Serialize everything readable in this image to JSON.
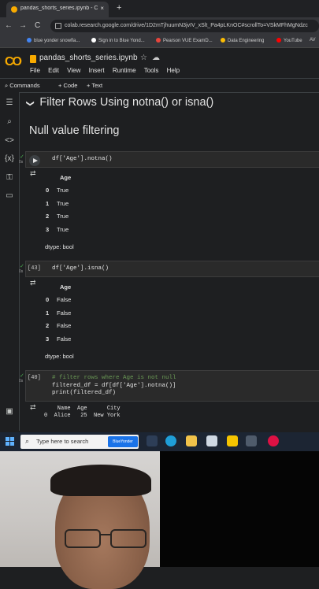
{
  "browser": {
    "tab_title": "pandas_shorts_series.ipynb - C",
    "tab_close": "×",
    "new_tab": "+",
    "url": "colab.research.google.com/drive/1D2mTjhuumN3jvIV_xSlt_Pa4pLKnOC#scrollTo=VSkMFhMgNdzc",
    "back": "←",
    "forward": "→",
    "reload": "C",
    "bookmarks": [
      {
        "label": "blue yonder snowfla...",
        "color": "#4285f4"
      },
      {
        "label": "Sign in to Blue Yond...",
        "color": "#ffffff"
      },
      {
        "label": "Pearson VUE ExamD...",
        "color": "#e8453c"
      },
      {
        "label": "Data Engineering",
        "color": "#fbbc04"
      },
      {
        "label": "YouTube",
        "color": "#ff0000"
      },
      {
        "label": "AV",
        "color": "#aaaaaa"
      }
    ]
  },
  "colab": {
    "logo": "CO",
    "notebook_title": "pandas_shorts_series.ipynb",
    "star": "☆",
    "cloud": "☁",
    "menu": [
      "File",
      "Edit",
      "View",
      "Insert",
      "Runtime",
      "Tools",
      "Help"
    ],
    "toolbar": {
      "commands": "Commands",
      "code": "+ Code",
      "text": "+ Text"
    }
  },
  "rail_icons": [
    "menu-icon",
    "search-icon",
    "code-icon",
    "variables-icon",
    "key-icon",
    "folder-icon",
    "terminal-icon"
  ],
  "content": {
    "heading1": "Filter Rows Using notna() or isna()",
    "heading1_chevron": "❯",
    "heading2": "Null value filtering",
    "cell1": {
      "code": "df['Age'].notna()",
      "check": "✓",
      "time": "0s",
      "table_header": "Age",
      "rows": [
        {
          "idx": "0",
          "val": "True"
        },
        {
          "idx": "1",
          "val": "True"
        },
        {
          "idx": "2",
          "val": "True"
        },
        {
          "idx": "3",
          "val": "True"
        }
      ],
      "dtype": "dtype: bool"
    },
    "cell2": {
      "exec": "[43]",
      "code": "df['Age'].isna()",
      "check": "✓",
      "time": "0s",
      "table_header": "Age",
      "rows": [
        {
          "idx": "0",
          "val": "False"
        },
        {
          "idx": "1",
          "val": "False"
        },
        {
          "idx": "2",
          "val": "False"
        },
        {
          "idx": "3",
          "val": "False"
        }
      ],
      "dtype": "dtype: bool"
    },
    "cell3": {
      "exec": "[40]",
      "check": "✓",
      "time": "0s",
      "code_line1": "# filter rows where Age is not null",
      "code_line2": "filtered_df = df[df['Age'].notna()]",
      "code_line3": "print(filtered_df)",
      "output_header": "    Name  Age      City",
      "output_row0": "0  Alice   25  New York"
    }
  },
  "taskbar": {
    "search_placeholder": "Type here to search",
    "search_icon": "⌕",
    "badge": "BlueYonder"
  }
}
